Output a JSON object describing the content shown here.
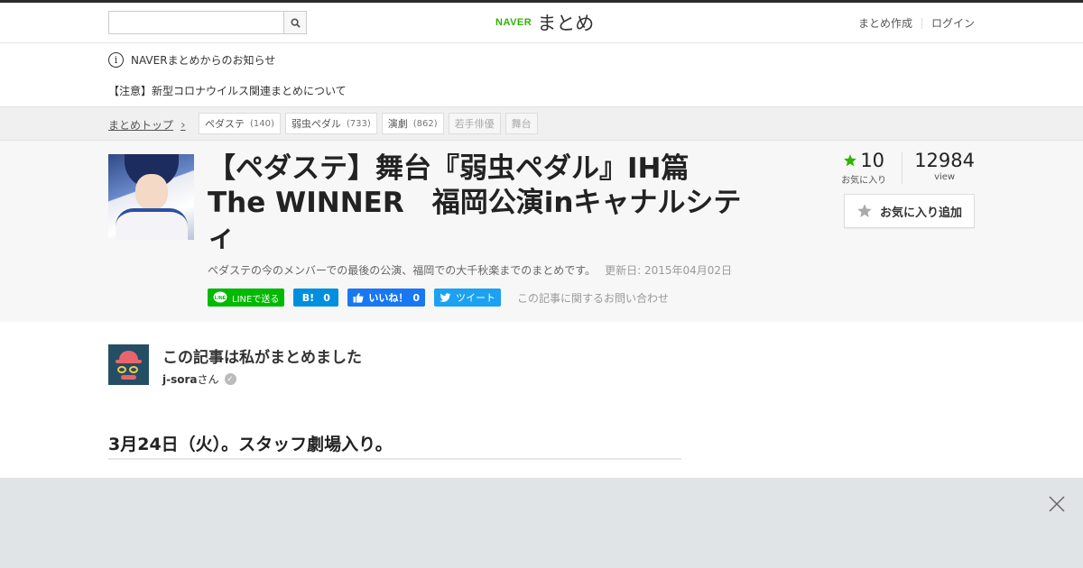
{
  "header": {
    "search_placeholder": "",
    "logo_naver": "NAVER",
    "logo_matome": "まとめ",
    "create_link": "まとめ作成",
    "login_link": "ログイン"
  },
  "notice": {
    "icon_char": "i",
    "label": "NAVERまとめからのお知らせ",
    "link": "【注意】新型コロナウイルス関連まとめについて"
  },
  "breadcrumb": {
    "top": "まとめトップ",
    "chevron": "›"
  },
  "tags": [
    {
      "label": "ペダステ",
      "count": "(140)"
    },
    {
      "label": "弱虫ペダル",
      "count": "(733)"
    },
    {
      "label": "演劇",
      "count": "(862)"
    },
    {
      "label": "若手俳優",
      "count": ""
    },
    {
      "label": "舞台",
      "count": ""
    }
  ],
  "article": {
    "title": "【ペダステ】舞台『弱虫ペダル』IH篇 The WINNER　福岡公演inキャナルシティ",
    "description": "ペダステの今のメンバーでの最後の公演、福岡での大千秋楽までのまとめです。",
    "updated": "更新日: 2015年04月02日",
    "favorites": "10",
    "favorites_label": "お気に入り",
    "views": "12984",
    "views_label": "view",
    "fav_button": "お気に入り追加",
    "inquiry": "この記事に関するお問い合わせ"
  },
  "share": {
    "line": "LINEで送る",
    "hatena_mark": "B!",
    "hatena_count": "0",
    "fb_label": "いいね！",
    "fb_count": "0",
    "tweet": "ツイート"
  },
  "author": {
    "heading": "この記事は私がまとめました",
    "name": "j-sora",
    "suffix": "さん"
  },
  "content": {
    "heading": "3月24日（火）。スタッフ劇場入り。"
  },
  "colors": {
    "naver_green": "#2db400",
    "star_green": "#2db400",
    "line_green": "#00b900",
    "hatena_blue": "#008fde",
    "fb_blue": "#1877f2",
    "twitter_blue": "#1da1f2"
  }
}
